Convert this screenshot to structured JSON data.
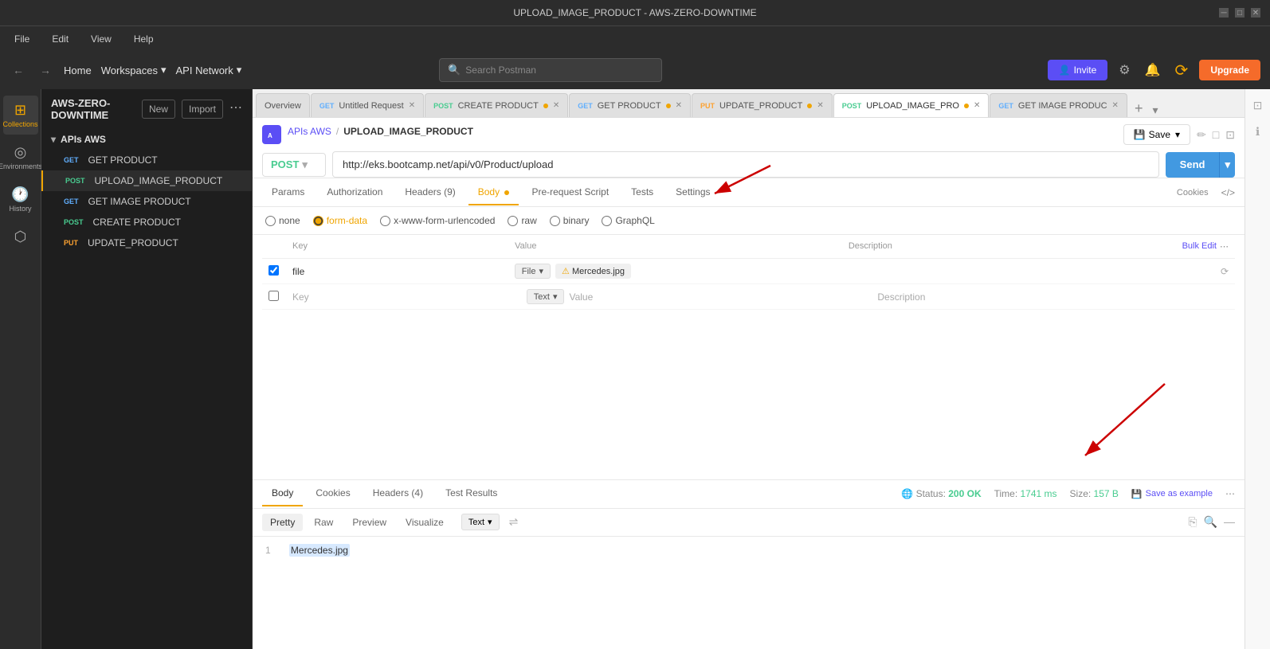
{
  "titleBar": {
    "title": "UPLOAD_IMAGE_PRODUCT - AWS-ZERO-DOWNTIME"
  },
  "menuBar": {
    "items": [
      "File",
      "Edit",
      "View",
      "Help"
    ]
  },
  "topNav": {
    "back": "←",
    "forward": "→",
    "home": "Home",
    "workspaces": "Workspaces",
    "apiNetwork": "API Network",
    "search": "Search Postman",
    "inviteLabel": "Invite",
    "upgradeLabel": "Upgrade"
  },
  "sidebar": {
    "icons": [
      {
        "name": "collections",
        "icon": "⊞",
        "label": "Collections",
        "active": true
      },
      {
        "name": "environments",
        "icon": "◎",
        "label": "Environments"
      },
      {
        "name": "history",
        "icon": "🕐",
        "label": "History"
      },
      {
        "name": "mock",
        "icon": "⬡",
        "label": ""
      }
    ]
  },
  "collectionsPanel": {
    "workspaceName": "AWS-ZERO-DOWNTIME",
    "newLabel": "New",
    "importLabel": "Import",
    "groupName": "APIs AWS",
    "items": [
      {
        "method": "GET",
        "name": "GET PRODUCT"
      },
      {
        "method": "POST",
        "name": "UPLOAD_IMAGE_PRODUCT",
        "active": true
      },
      {
        "method": "GET",
        "name": "GET IMAGE PRODUCT"
      },
      {
        "method": "POST",
        "name": "CREATE PRODUCT"
      },
      {
        "method": "PUT",
        "name": "UPDATE_PRODUCT"
      }
    ]
  },
  "tabs": [
    {
      "label": "Overview",
      "method": "",
      "type": "overview"
    },
    {
      "label": "Untitled Request",
      "method": "GET",
      "dot": false
    },
    {
      "label": "CREATE PRODUCT",
      "method": "POST",
      "dot": true
    },
    {
      "label": "GET PRODUCT",
      "method": "GET",
      "dot": true
    },
    {
      "label": "UPDATE_PRODUCT",
      "method": "PUT",
      "dot": true
    },
    {
      "label": "UPLOAD_IMAGE_PRO",
      "method": "POST",
      "dot": true,
      "active": true
    },
    {
      "label": "GET IMAGE PRODUC",
      "method": "GET",
      "dot": false
    }
  ],
  "breadcrumb": {
    "parent": "APIs AWS",
    "current": "UPLOAD_IMAGE_PRODUCT"
  },
  "request": {
    "method": "POST",
    "url": "http://eks.bootcamp.net/api/v0/Product/upload",
    "sendLabel": "Send"
  },
  "requestTabs": {
    "items": [
      "Params",
      "Authorization",
      "Headers (9)",
      "Body",
      "Pre-request Script",
      "Tests",
      "Settings"
    ],
    "active": "Body",
    "cookiesLabel": "Cookies",
    "codeLabel": "</->"
  },
  "bodyOptions": {
    "options": [
      "none",
      "form-data",
      "x-www-form-urlencoded",
      "raw",
      "binary",
      "GraphQL"
    ],
    "selected": "form-data"
  },
  "formTable": {
    "headers": [
      "Key",
      "Value",
      "Description"
    ],
    "bulkEdit": "Bulk Edit",
    "rows": [
      {
        "checked": true,
        "key": "file",
        "valueType": "File",
        "value": "Mercedes.jpg",
        "description": ""
      },
      {
        "checked": false,
        "key": "",
        "valueType": "Text",
        "value": "",
        "description": ""
      }
    ]
  },
  "responseTabs": {
    "items": [
      "Body",
      "Cookies",
      "Headers (4)",
      "Test Results"
    ],
    "active": "Body",
    "status": "200 OK",
    "time": "1741 ms",
    "size": "157 B",
    "saveExample": "Save as example"
  },
  "responseViewTabs": {
    "items": [
      "Pretty",
      "Raw",
      "Preview",
      "Visualize"
    ],
    "active": "Pretty",
    "format": "Text"
  },
  "responseBody": {
    "lineNumber": "1",
    "content": "Mercedes.jpg"
  }
}
